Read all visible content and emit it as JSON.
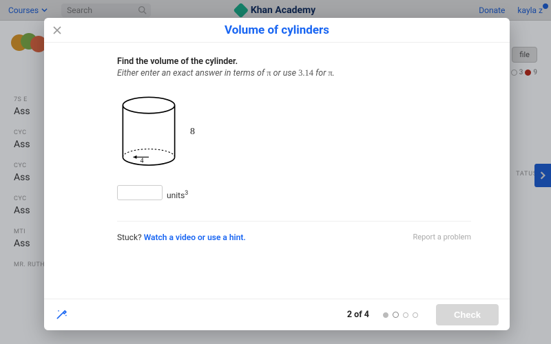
{
  "topbar": {
    "courses": "Courses",
    "search_placeholder": "Search",
    "brand": "Khan Academy",
    "donate": "Donate",
    "user": "kayla z"
  },
  "bg": {
    "file_button": "file",
    "score_a": "3",
    "score_b": "9",
    "status_label": "TATUS",
    "sidebar": [
      {
        "lab": "7S E",
        "big": "Ass"
      },
      {
        "lab": "CYC",
        "big": "Ass"
      },
      {
        "lab": "CYC",
        "big": "Ass"
      },
      {
        "lab": "CYC",
        "big": "Ass"
      },
      {
        "lab": "MTI",
        "big": "Ass"
      }
    ],
    "footer_label": "MR. RUTHERFORD'S MATH WORLD"
  },
  "modal": {
    "title": "Volume of cylinders",
    "prompt_line1": "Find the volume of the cylinder.",
    "prompt_line2_a": "Either enter an exact answer in terms of ",
    "prompt_line2_pi1": "π",
    "prompt_line2_b": " or use ",
    "prompt_line2_num": "3.14",
    "prompt_line2_c": " for ",
    "prompt_line2_pi2": "π",
    "prompt_line2_d": ".",
    "cylinder": {
      "height": "8",
      "radius": "4"
    },
    "units_label": "units",
    "units_exp": "3",
    "stuck_label": "Stuck?",
    "stuck_link": "Watch a video or use a hint.",
    "report": "Report a problem",
    "progress": "2 of 4",
    "check": "Check"
  }
}
